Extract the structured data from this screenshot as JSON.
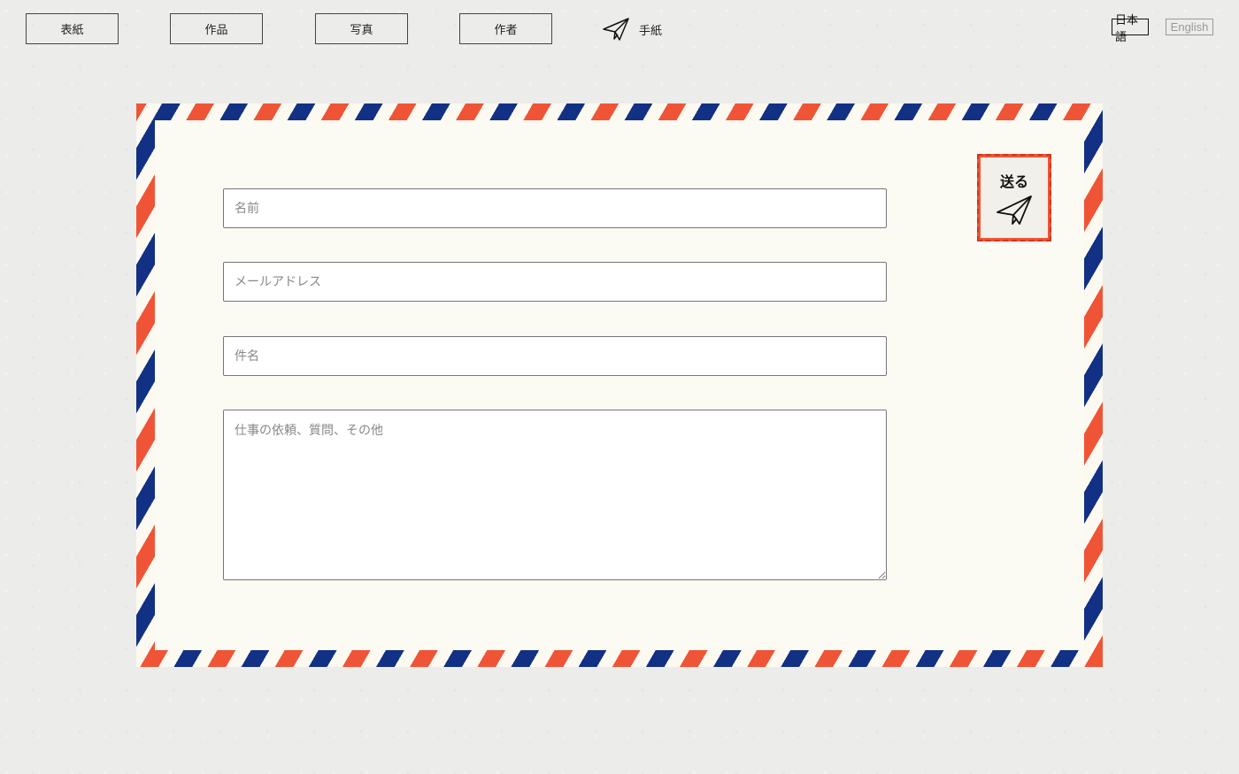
{
  "nav": {
    "items": [
      {
        "label": "表紙"
      },
      {
        "label": "作品"
      },
      {
        "label": "写真"
      },
      {
        "label": "作者"
      }
    ],
    "letter_label": "手紙",
    "letter_icon": "paper-plane-icon"
  },
  "language": {
    "ja": "日本語",
    "en": "English",
    "active": "ja"
  },
  "form": {
    "name_placeholder": "名前",
    "email_placeholder": "メールアドレス",
    "subject_placeholder": "件名",
    "message_placeholder": "仕事の依頼、質問、その他",
    "send_label": "送る",
    "send_icon": "paper-plane-icon"
  },
  "colors": {
    "stripe_red": "#f05436",
    "stripe_blue": "#123184",
    "envelope_paper": "#fbfaf3",
    "background": "#ececea"
  }
}
